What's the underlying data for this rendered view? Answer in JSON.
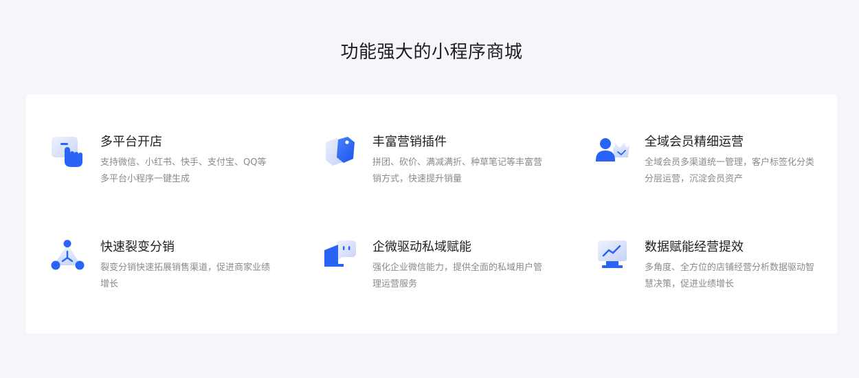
{
  "page": {
    "title": "功能强大的小程序商城"
  },
  "features": [
    {
      "title": "多平台开店",
      "desc": "支持微信、小红书、快手、支付宝、QQ等多平台小程序一键生成",
      "icon": "hand-tap-icon"
    },
    {
      "title": "丰富营销插件",
      "desc": "拼团、砍价、满减满折、种草笔记等丰富营销方式，快速提升销量",
      "icon": "price-tag-icon"
    },
    {
      "title": "全域会员精细运营",
      "desc": "全域会员多渠道统一管理，客户标签化分类分层运营，沉淀会员资产",
      "icon": "member-crown-icon"
    },
    {
      "title": "快速裂变分销",
      "desc": "裂变分销快速拓展销售渠道，促进商家业绩增长",
      "icon": "network-nodes-icon"
    },
    {
      "title": "企微驱动私域赋能",
      "desc": "强化企业微信能力，提供全面的私域用户管理运营服务",
      "icon": "chat-bubble-icon"
    },
    {
      "title": "数据赋能经营提效",
      "desc": "多角度、全方位的店铺经营分析数据驱动智慧决策，促进业绩增长",
      "icon": "monitor-chart-icon"
    }
  ],
  "colors": {
    "accent": "#2a64f6",
    "accent_light": "#dfe7fb",
    "background": "#f5f6fa",
    "card": "#ffffff"
  }
}
